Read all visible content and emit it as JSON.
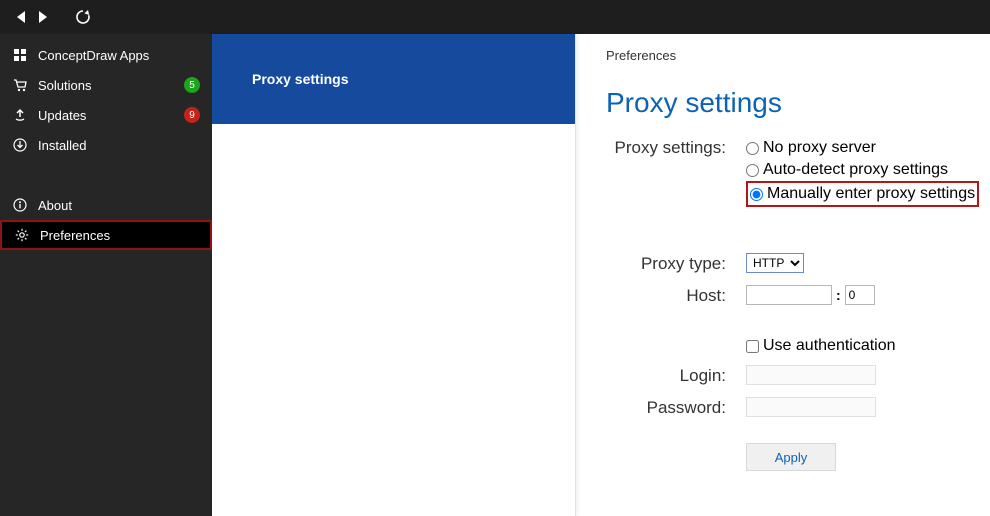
{
  "topbar": {},
  "sidebar": {
    "group1": [
      {
        "label": "ConceptDraw Apps",
        "badge": null
      },
      {
        "label": "Solutions",
        "badge": {
          "text": "5",
          "color": "green"
        }
      },
      {
        "label": "Updates",
        "badge": {
          "text": "9",
          "color": "red"
        }
      },
      {
        "label": "Installed",
        "badge": null
      }
    ],
    "group2": [
      {
        "label": "About"
      },
      {
        "label": "Preferences"
      }
    ]
  },
  "mid": {
    "header": "Proxy settings"
  },
  "content": {
    "breadcrumb": "Preferences",
    "title": "Proxy settings",
    "proxy_label": "Proxy settings:",
    "radio1": "No proxy server",
    "radio2": "Auto-detect proxy settings",
    "radio3": "Manually enter proxy settings",
    "proxytype_label": "Proxy type:",
    "proxytype_value": "HTTP",
    "host_label": "Host:",
    "host_value": "",
    "port_value": "0",
    "useauth_label": "Use authentication",
    "login_label": "Login:",
    "login_value": "",
    "password_label": "Password:",
    "password_value": "",
    "apply_label": "Apply"
  }
}
